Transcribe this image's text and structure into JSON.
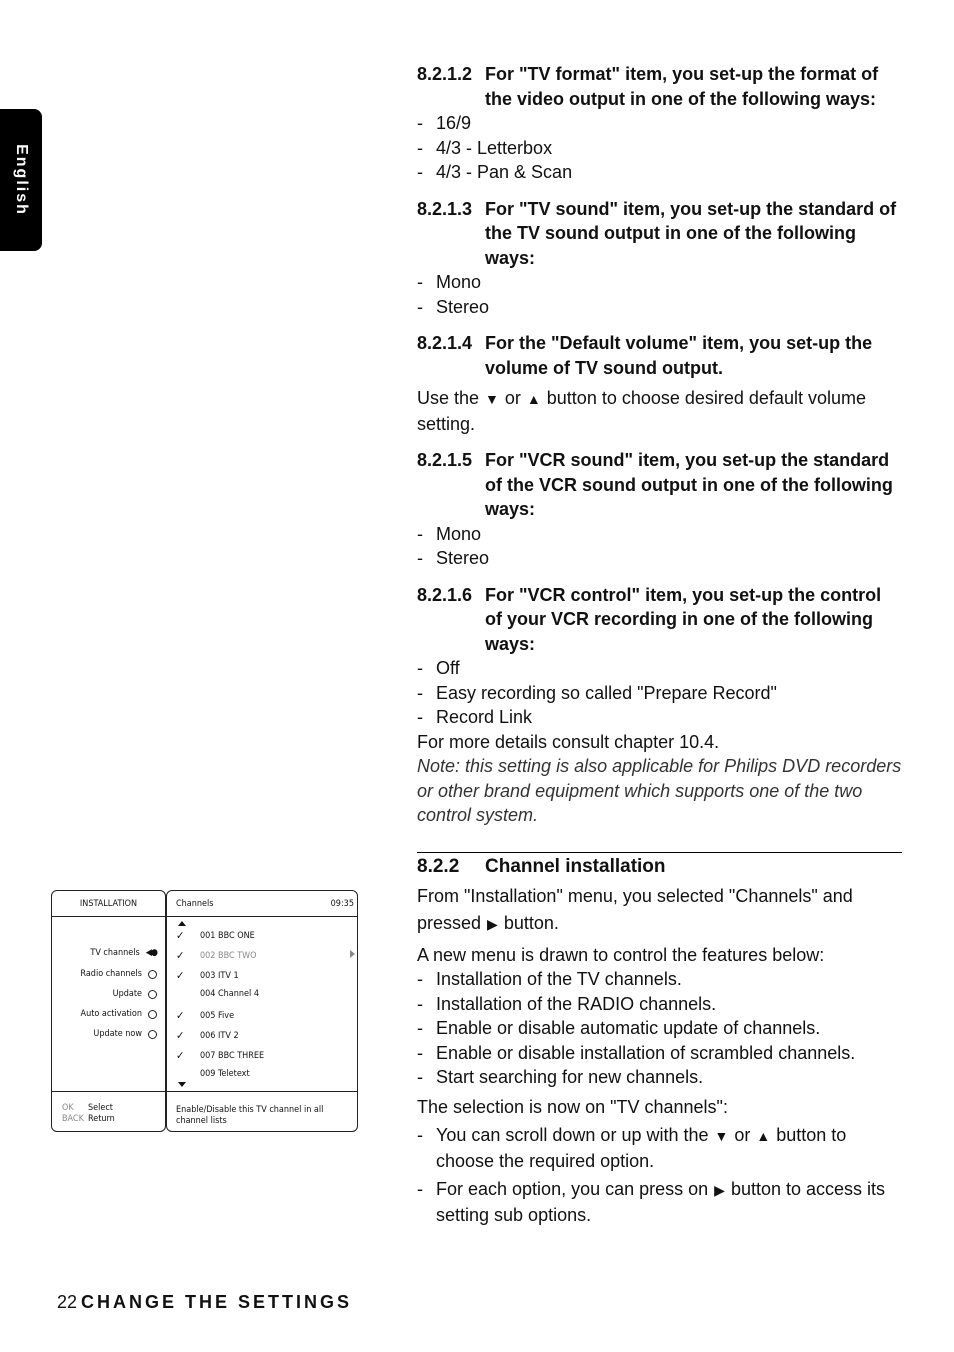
{
  "side_tab": {
    "label": "English"
  },
  "sections": [
    {
      "num": "8.2.1.2",
      "heading": "For \"TV format\" item, you set-up the format of the video output in one of the following ways:",
      "items": [
        "16/9",
        "4/3 - Letterbox",
        "4/3 - Pan & Scan"
      ]
    },
    {
      "num": "8.2.1.3",
      "heading": "For \"TV sound\" item, you set-up the standard of the TV sound output in one of the following ways:",
      "items": [
        "Mono",
        "Stereo"
      ]
    },
    {
      "num": "8.2.1.4",
      "heading": "For the \"Default volume\" item, you set-up the volume of TV sound output.",
      "body_pre": "Use the",
      "body_or": "or",
      "body_post": "button to choose desired default volume setting.",
      "icons": {
        "down": "▼",
        "up": "▲"
      }
    },
    {
      "num": "8.2.1.5",
      "heading": "For \"VCR sound\" item, you set-up the standard of the VCR sound output in one of the following ways:",
      "items": [
        "Mono",
        "Stereo"
      ]
    },
    {
      "num": "8.2.1.6",
      "heading": "For \"VCR control\" item, you set-up the control of your VCR recording in one of the following ways:",
      "items": [
        "Off",
        "Easy recording so called \"Prepare Record\"",
        "Record Link"
      ],
      "after": "For more details consult chapter 10.4.",
      "note": "Note: this setting is also applicable for Philips DVD recorders or other brand equipment which supports one of the two control system."
    }
  ],
  "channel_installation": {
    "num": "8.2.2",
    "heading": "Channel installation",
    "intro_pre": "From \"Installation\" menu, you selected \"Channels\" and pressed",
    "intro_post": "button.",
    "right_icon": "▶",
    "features_intro": "A new menu is drawn to control the features below:",
    "features": [
      "Installation of the TV channels.",
      "Installation of the RADIO channels.",
      "Enable or disable automatic update of channels.",
      "Enable or disable installation of scrambled channels.",
      "Start searching for new channels."
    ],
    "selection_text": "The selection is now on \"TV channels\":",
    "tip1_pre": "You can scroll down or up with the",
    "tip1_or": "or",
    "tip1_post": "button to choose the required option.",
    "tip2_pre": "For each option, you can press on",
    "tip2_post": "button to access its setting sub options.",
    "down_icon": "▼",
    "up_icon": "▲"
  },
  "menu": {
    "left_title": "INSTALLATION",
    "options": [
      {
        "label": "TV channels",
        "state": "selected"
      },
      {
        "label": "Radio channels",
        "state": "radio"
      },
      {
        "label": "Update",
        "state": "radio"
      },
      {
        "label": "Auto activation",
        "state": "radio"
      },
      {
        "label": "Update now",
        "state": "radio"
      }
    ],
    "footer_keys": [
      {
        "key": "OK",
        "action": "Select"
      },
      {
        "key": "BACK",
        "action": "Return"
      }
    ],
    "right_title": "Channels",
    "time": "09:35",
    "channels": [
      {
        "name": "001 BBC ONE",
        "checked": true,
        "dim": false
      },
      {
        "name": "002 BBC TWO",
        "checked": true,
        "dim": true
      },
      {
        "name": "003 ITV 1",
        "checked": true,
        "dim": false
      },
      {
        "name": "004 Channel 4",
        "checked": false,
        "dim": false
      },
      {
        "name": "005 Five",
        "checked": true,
        "dim": false
      },
      {
        "name": "006 ITV 2",
        "checked": true,
        "dim": false
      },
      {
        "name": "007 BBC THREE",
        "checked": true,
        "dim": false
      },
      {
        "name": "009 Teletext",
        "checked": false,
        "dim": false
      }
    ],
    "help_text": "Enable/Disable this TV channel in all channel lists"
  },
  "footer": {
    "page": "22",
    "title": "CHANGE THE SETTINGS"
  }
}
